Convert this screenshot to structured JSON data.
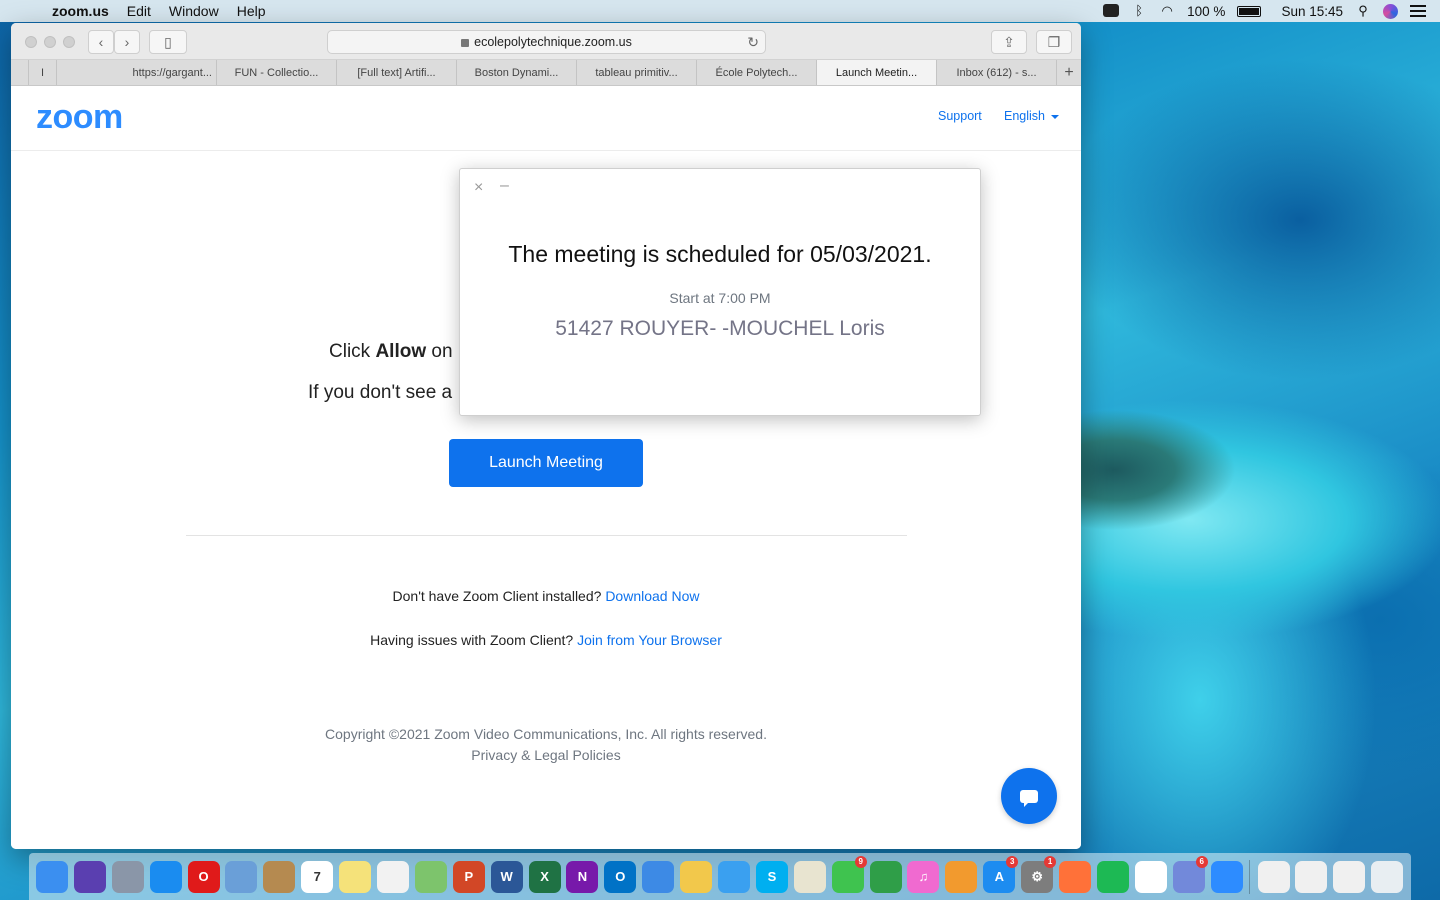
{
  "menubar": {
    "app_name": "zoom.us",
    "items": [
      "Edit",
      "Window",
      "Help"
    ],
    "battery": "100 %",
    "clock": "Sun 15:45"
  },
  "browser": {
    "url": "ecolepolytechnique.zoom.us",
    "tabs": [
      {
        "label": ""
      },
      {
        "label": "I"
      },
      {
        "label": "https://gargant..."
      },
      {
        "label": "FUN - Collectio..."
      },
      {
        "label": "[Full text] Artifi..."
      },
      {
        "label": "Boston Dynami..."
      },
      {
        "label": "tableau primitiv..."
      },
      {
        "label": "École Polytech..."
      },
      {
        "label": "Launch Meetin..."
      },
      {
        "label": "Inbox (612) - s..."
      }
    ],
    "active_tab_index": 8
  },
  "page": {
    "logo": "zoom",
    "support": "Support",
    "language": "English",
    "click_allow_pre": "Click ",
    "click_allow_bold": "Allow",
    "click_allow_post": " on",
    "dont_see": "If you don't see a",
    "launch_button": "Launch Meeting",
    "no_client_text": "Don't have Zoom Client installed? ",
    "download_link": "Download Now",
    "issues_text": "Having issues with Zoom Client? ",
    "join_browser_link": "Join from Your Browser",
    "copyright": "Copyright ©2021 Zoom Video Communications, Inc. All rights reserved.",
    "privacy": "Privacy & Legal Policies"
  },
  "modal": {
    "close_glyph": "×",
    "minimize_glyph": "–",
    "title": "The meeting is scheduled for 05/03/2021.",
    "start": "Start at 7:00 PM",
    "topic": "51427 ROUYER- -MOUCHEL Loris"
  },
  "dock": [
    {
      "name": "finder-icon",
      "color": "#3b8ff0",
      "glyph": ""
    },
    {
      "name": "siri-icon",
      "color": "#5a3fb0",
      "glyph": ""
    },
    {
      "name": "launchpad-icon",
      "color": "#8a96a8",
      "glyph": ""
    },
    {
      "name": "safari-icon",
      "color": "#1a8cf0",
      "glyph": ""
    },
    {
      "name": "opera-icon",
      "color": "#e01a1a",
      "glyph": "O"
    },
    {
      "name": "preview-icon",
      "color": "#6a9fd8",
      "glyph": ""
    },
    {
      "name": "notefile-icon",
      "color": "#b58a50",
      "glyph": ""
    },
    {
      "name": "calendar-icon",
      "color": "#ffffff",
      "glyph": "7"
    },
    {
      "name": "notes-icon",
      "color": "#f5e27a",
      "glyph": ""
    },
    {
      "name": "reminders-icon",
      "color": "#f2f2f2",
      "glyph": ""
    },
    {
      "name": "maps-icon",
      "color": "#7dc46c",
      "glyph": ""
    },
    {
      "name": "powerpoint-icon",
      "color": "#d24726",
      "glyph": "P"
    },
    {
      "name": "word-icon",
      "color": "#2b5797",
      "glyph": "W"
    },
    {
      "name": "excel-icon",
      "color": "#1f7244",
      "glyph": "X"
    },
    {
      "name": "onenote-icon",
      "color": "#7719aa",
      "glyph": "N"
    },
    {
      "name": "outlook-icon",
      "color": "#0072c6",
      "glyph": "O"
    },
    {
      "name": "keynote-icon",
      "color": "#3d8ae5",
      "glyph": ""
    },
    {
      "name": "photos-icon",
      "color": "#f2c84b",
      "glyph": ""
    },
    {
      "name": "messages-bubble-icon",
      "color": "#3aa0f0",
      "glyph": ""
    },
    {
      "name": "skype-icon",
      "color": "#00aff0",
      "glyph": "S"
    },
    {
      "name": "script-editor-icon",
      "color": "#e8e4d0",
      "glyph": ""
    },
    {
      "name": "facetime-icon",
      "color": "#3fc34f",
      "glyph": "",
      "badge": "9"
    },
    {
      "name": "numbers-icon",
      "color": "#2f9e48",
      "glyph": ""
    },
    {
      "name": "itunes-icon",
      "color": "#f06ad0",
      "glyph": "♫"
    },
    {
      "name": "books-icon",
      "color": "#f29a2e",
      "glyph": ""
    },
    {
      "name": "app-store-icon",
      "color": "#1d8cf0",
      "glyph": "A",
      "badge": "3"
    },
    {
      "name": "system-preferences-icon",
      "color": "#7d7d7d",
      "glyph": "⚙",
      "badge": "1"
    },
    {
      "name": "firefox-icon",
      "color": "#ff7139",
      "glyph": ""
    },
    {
      "name": "spotify-icon",
      "color": "#1db954",
      "glyph": ""
    },
    {
      "name": "chrome-icon",
      "color": "#ffffff",
      "glyph": ""
    },
    {
      "name": "discord-icon",
      "color": "#7289da",
      "glyph": "",
      "badge": "6"
    },
    {
      "name": "zoom-icon",
      "color": "#2d8cff",
      "glyph": ""
    },
    {
      "name": "separator"
    },
    {
      "name": "recent-document-1-icon",
      "color": "#f0f0f0",
      "glyph": ""
    },
    {
      "name": "recent-document-2-icon",
      "color": "#f0f0f0",
      "glyph": ""
    },
    {
      "name": "recent-document-3-icon",
      "color": "#f0f0f0",
      "glyph": ""
    },
    {
      "name": "trash-icon",
      "color": "#e8eef2",
      "glyph": ""
    }
  ]
}
